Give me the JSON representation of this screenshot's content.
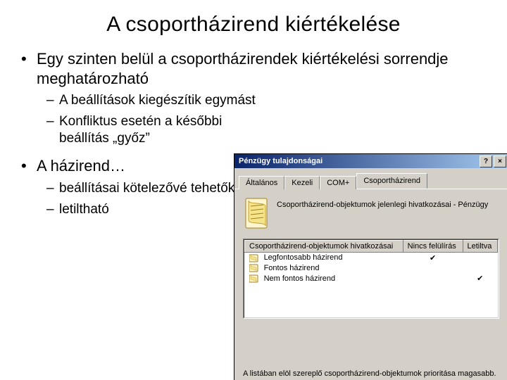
{
  "title": "A csoportházirend kiértékelése",
  "bullets": {
    "b1": "Egy szinten belül a csoportházirendek kiértékelési sorrendje meghatározható",
    "b1s1": "A beállítások kiegészítik egymást",
    "b1s2": "Konfliktus esetén a későbbi beállítás „győz”",
    "b2": "A házirend…",
    "b2s1": "beállításai kötelezővé tehetők",
    "b2s2": "letiltható"
  },
  "dialog": {
    "title": "Pénzügy tulajdonságai",
    "help": "?",
    "close": "×",
    "tabs": {
      "t1": "Általános",
      "t2": "Kezeli",
      "t3": "COM+",
      "t4": "Csoportházirend"
    },
    "heading": "Csoportházirend-objektumok jelenlegi hivatkozásai - Pénzügy",
    "cols": {
      "c1": "Csoportházirend-objektumok hivatkozásai",
      "c2": "Nincs felülírás",
      "c3": "Letiltva"
    },
    "rows": {
      "r1": "Legfontosabb házirend",
      "r2": "Fontos házirend",
      "r3": "Nem fontos házirend"
    },
    "check": "✔",
    "footnote": "A listában elöl szereplő csoportházirend-objektumok prioritása magasabb."
  }
}
